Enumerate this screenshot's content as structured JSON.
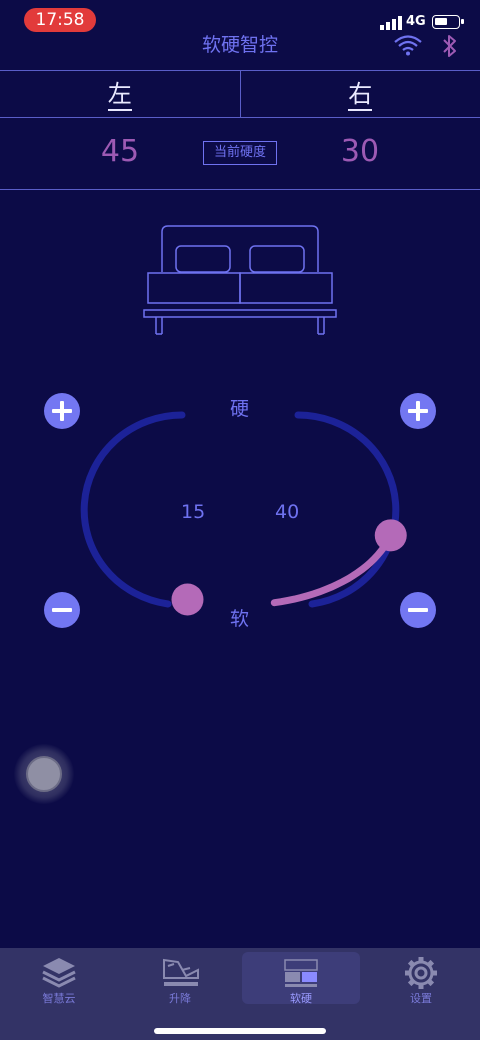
{
  "status_bar": {
    "time": "17:58",
    "network": "4G"
  },
  "nav": {
    "title": "软硬智控"
  },
  "sides": {
    "left": "左",
    "right": "右"
  },
  "hardness": {
    "label": "当前硬度",
    "left_value": "45",
    "right_value": "30"
  },
  "gauge": {
    "top_label": "硬",
    "bottom_label": "软",
    "left_value": "15",
    "right_value": "40",
    "left_level": 0.15,
    "right_level": 0.4
  },
  "colors": {
    "background": "#0c0b47",
    "accent": "#6f72f0",
    "value": "#9d5ab4",
    "track": "#1c2298",
    "knob": "#b46ab8"
  },
  "tabs": [
    {
      "label": "智慧云",
      "icon": "layers-icon"
    },
    {
      "label": "升降",
      "icon": "bed-lift-icon"
    },
    {
      "label": "软硬",
      "icon": "bed-firmness-icon"
    },
    {
      "label": "设置",
      "icon": "gear-icon"
    }
  ]
}
